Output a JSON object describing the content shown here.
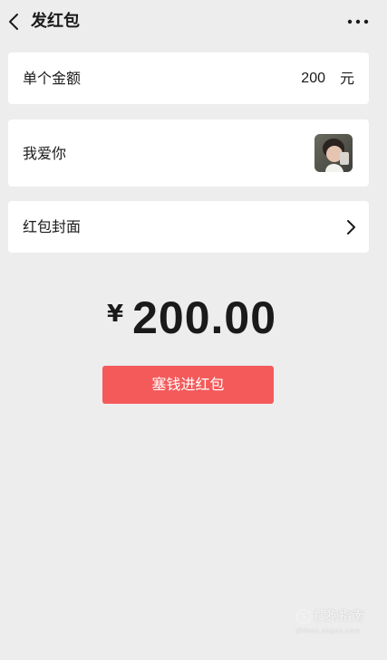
{
  "header": {
    "title": "发红包",
    "back_icon": "chevron-left-icon",
    "more_icon": "more-dots-icon"
  },
  "amount_row": {
    "label": "单个金额",
    "value": "200",
    "unit": "元"
  },
  "message_row": {
    "label": "我爱你",
    "sticker": "sticker-thumbnail"
  },
  "cover_row": {
    "label": "红包封面",
    "chevron_icon": "chevron-right-icon"
  },
  "total": {
    "currency": "¥",
    "value": "200.00"
  },
  "send_button": {
    "label": "塞钱进红包",
    "color": "#f45a5a"
  },
  "watermark": {
    "text": "搜狗指南",
    "url": "zhinan.sogou.com"
  },
  "colors": {
    "background": "#ededed",
    "card": "#ffffff",
    "accent": "#f45a5a"
  }
}
